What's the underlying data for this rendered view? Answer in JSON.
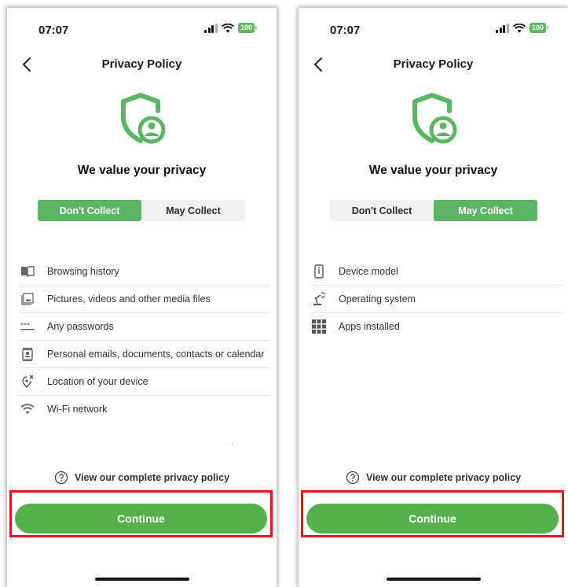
{
  "screens": [
    {
      "status": {
        "time": "07:07",
        "battery": "100"
      },
      "header": {
        "title": "Privacy Policy"
      },
      "heading": "We value your privacy",
      "tabs": [
        {
          "label": "Don't Collect",
          "active": true
        },
        {
          "label": "May Collect",
          "active": false
        }
      ],
      "items": [
        {
          "label": "Browsing history",
          "icon": "book-icon"
        },
        {
          "label": "Pictures, videos and other media files",
          "icon": "image-icon"
        },
        {
          "label": "Any passwords",
          "icon": "password-icon"
        },
        {
          "label": "Personal emails, documents, contacts or calendar",
          "icon": "contacts-icon"
        },
        {
          "label": "Location of your device",
          "icon": "location-off-icon"
        },
        {
          "label": "Wi-Fi network",
          "icon": "wifi-icon"
        }
      ],
      "policy_link": "View our complete privacy policy",
      "continue_label": "Continue"
    },
    {
      "status": {
        "time": "07:07",
        "battery": "100"
      },
      "header": {
        "title": "Privacy Policy"
      },
      "heading": "We value your privacy",
      "tabs": [
        {
          "label": "Don't Collect",
          "active": false
        },
        {
          "label": "May Collect",
          "active": true
        }
      ],
      "items": [
        {
          "label": "Device model",
          "icon": "device-icon"
        },
        {
          "label": "Operating system",
          "icon": "robot-arm-icon"
        },
        {
          "label": "Apps installed",
          "icon": "apps-grid-icon"
        }
      ],
      "policy_link": "View our complete privacy policy",
      "continue_label": "Continue"
    }
  ],
  "colors": {
    "accent": "#55b04c",
    "highlight_border": "#e8141d"
  }
}
